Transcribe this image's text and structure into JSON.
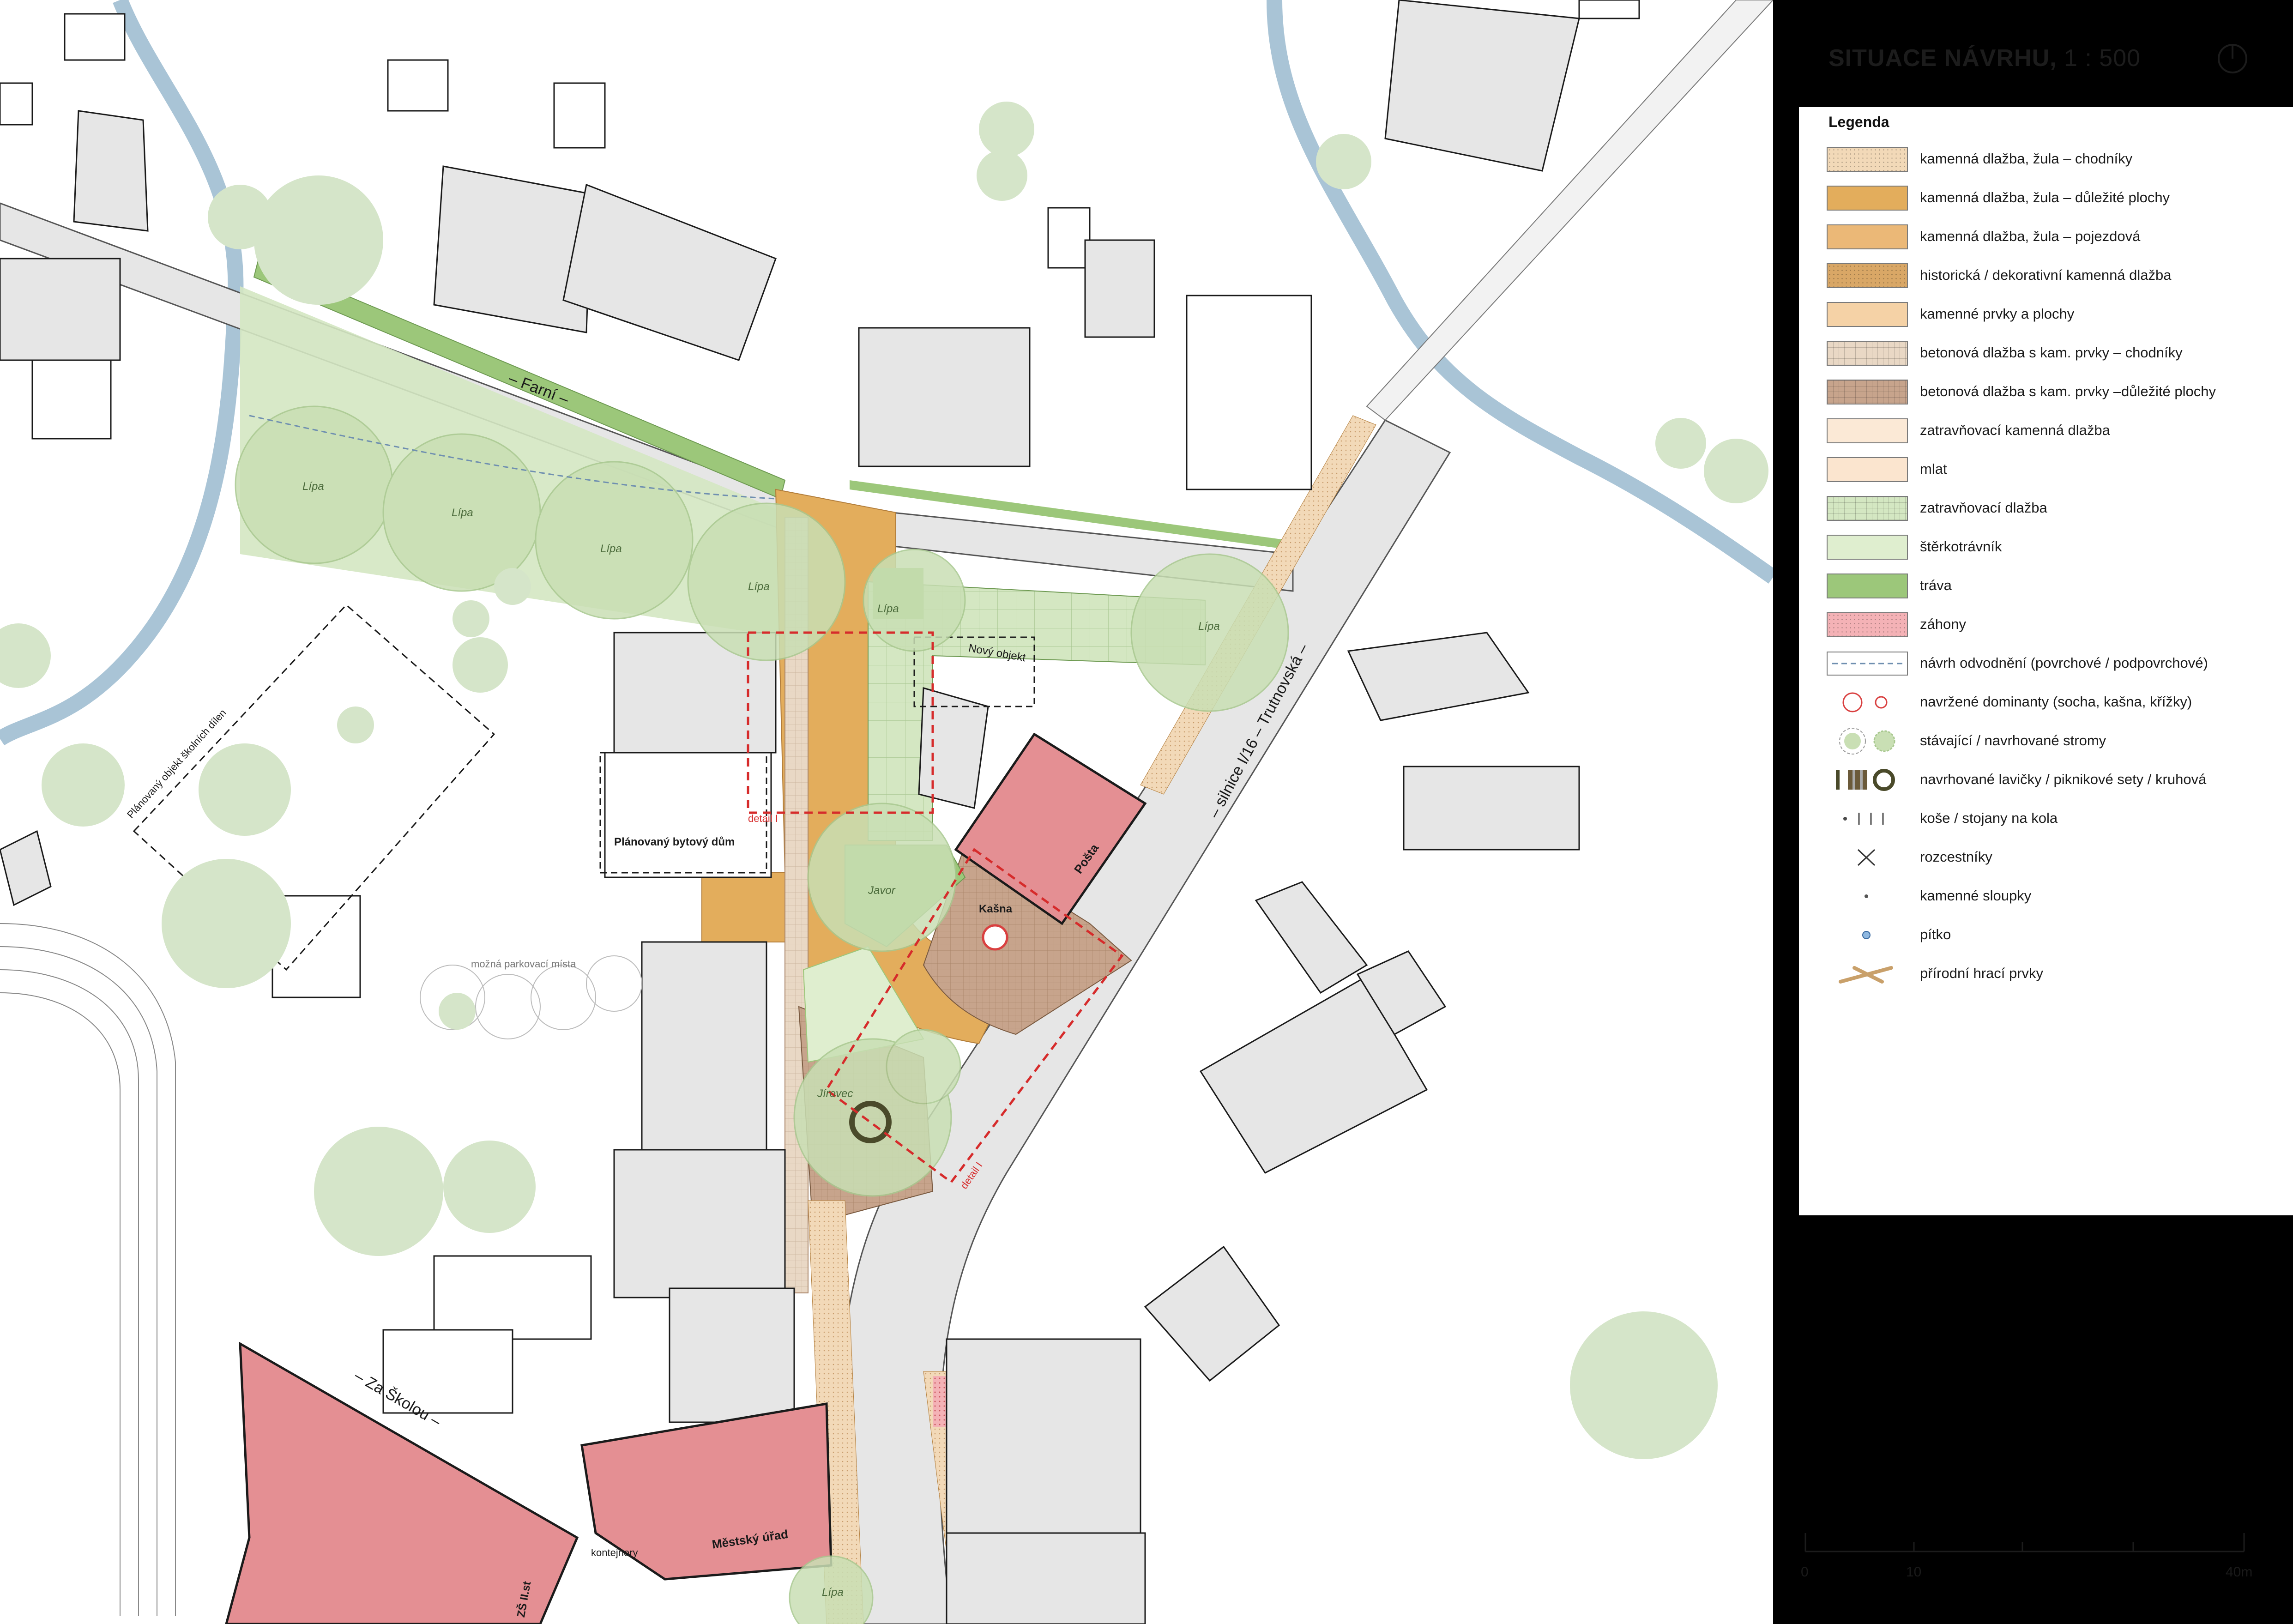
{
  "title": {
    "main": "SITUACE NÁVRHU",
    "scale": " 1 : 500"
  },
  "north_arrow": "north-arrow-icon",
  "legend": {
    "title": "Legenda",
    "items": [
      {
        "label": "kamenná dlažba, žula – chodníky",
        "kind": "swatch",
        "color": "#f2d9b8",
        "pattern": "dots"
      },
      {
        "label": "kamenná dlažba, žula – důležité plochy",
        "kind": "swatch",
        "color": "#e3ad5c"
      },
      {
        "label": "kamenná dlažba, žula – pojezdová",
        "kind": "swatch",
        "color": "#ebb877"
      },
      {
        "label": "historická / dekorativní kamenná dlažba",
        "kind": "swatch",
        "color": "#d9a766",
        "pattern": "dots"
      },
      {
        "label": "kamenné prvky a plochy",
        "kind": "swatch",
        "color": "#f5d2a6"
      },
      {
        "label": "betonová dlažba s kam. prvky – chodníky",
        "kind": "swatch",
        "color": "#e9d8c5",
        "pattern": "grid"
      },
      {
        "label": "betonová dlažba s kam. prvky –důležité plochy",
        "kind": "swatch",
        "color": "#c7a48c",
        "pattern": "grid"
      },
      {
        "label": "zatravňovací kamenná dlažba",
        "kind": "swatch",
        "color": "#fbe9d6"
      },
      {
        "label": "mlat",
        "kind": "swatch",
        "color": "#fbe5cf"
      },
      {
        "label": "zatravňovací dlažba",
        "kind": "swatch",
        "color": "#d4e7c2",
        "pattern": "grid"
      },
      {
        "label": "štěrkotrávník",
        "kind": "swatch",
        "color": "#dfeecf"
      },
      {
        "label": "tráva",
        "kind": "swatch",
        "color": "#9cc77a"
      },
      {
        "label": "záhony",
        "kind": "swatch",
        "color": "#f4b2b6",
        "pattern": "dots"
      },
      {
        "label": "návrh odvodnění (povrchové / podpovrchové)",
        "kind": "drainage"
      },
      {
        "label": "navržené dominanty (socha, kašna, křížky)",
        "kind": "dominants"
      },
      {
        "label": "stávající / navrhované stromy",
        "kind": "trees"
      },
      {
        "label": "navrhované lavičky / piknikové sety / kruhová",
        "kind": "benches"
      },
      {
        "label": "koše / stojany na kola",
        "kind": "bins"
      },
      {
        "label": "rozcestníky",
        "kind": "signpost"
      },
      {
        "label": "kamenné sloupky",
        "kind": "bollard"
      },
      {
        "label": "pítko",
        "kind": "fountain"
      },
      {
        "label": "přírodní hrací prvky",
        "kind": "play"
      }
    ]
  },
  "scale_bar": {
    "labels": [
      "0",
      "10",
      "40m"
    ]
  },
  "map": {
    "streets": [
      {
        "name": "– Farní –"
      },
      {
        "name": "– silnice I/16 – Trutnovská –"
      },
      {
        "name": "– Za Školou –"
      }
    ],
    "buildings": [
      {
        "name": "Pošta"
      },
      {
        "name": "Městský úřad"
      },
      {
        "name": "Kašna"
      },
      {
        "name": "Nový objekt"
      },
      {
        "name": "Plánovaný bytový dům"
      },
      {
        "name": "Plánovaný objekt školních dílen"
      },
      {
        "name": "možná parkovací místa"
      },
      {
        "name": "kontejnery"
      },
      {
        "name": "ZŠ II.st"
      }
    ],
    "trees": [
      {
        "name": "Lípa"
      },
      {
        "name": "Lípa"
      },
      {
        "name": "Lípa"
      },
      {
        "name": "Lípa"
      },
      {
        "name": "Lípa"
      },
      {
        "name": "Lípa"
      },
      {
        "name": "Javor"
      },
      {
        "name": "Jírovec"
      },
      {
        "name": "Lípa"
      }
    ],
    "details": [
      {
        "name": "detail I"
      },
      {
        "name": "detail I"
      }
    ]
  },
  "colors": {
    "river": "#a9c4d6",
    "building_red": "#e48f93",
    "paving_orange": "#e3ad5c",
    "grass": "#9cc77a",
    "tree_canopy": "#c9dfb4",
    "road": "#e6e6e6",
    "building_grey": "#e6e6e6",
    "detail_red": "#d62b2b"
  }
}
